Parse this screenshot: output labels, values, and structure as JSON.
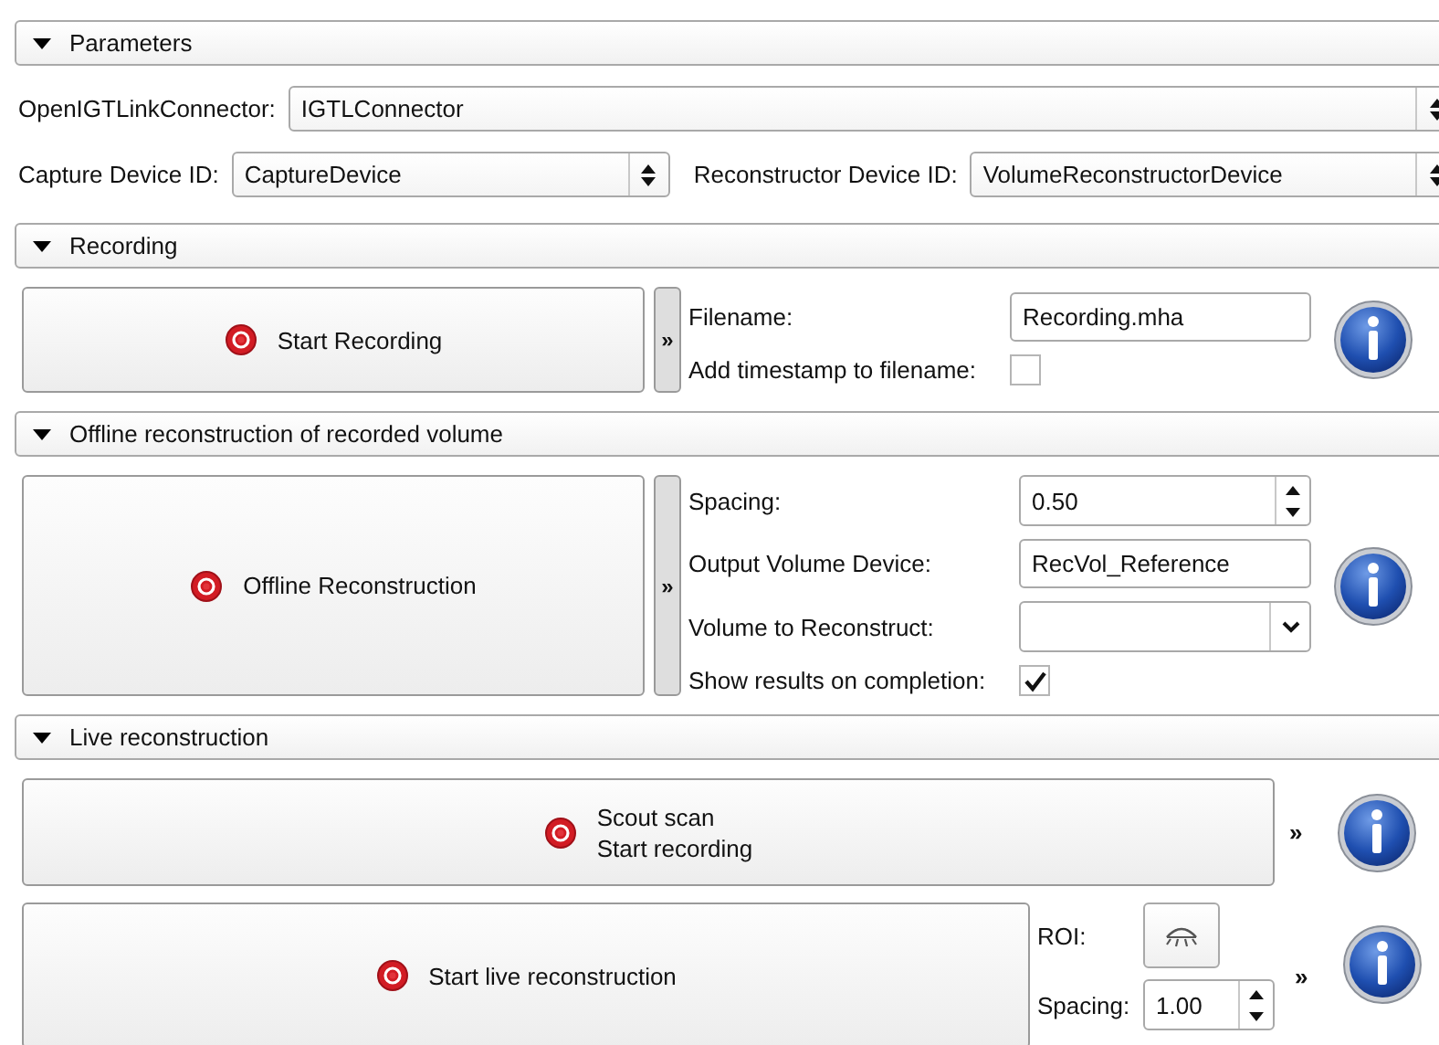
{
  "sections": [
    {
      "kind": "parameters",
      "title": "Parameters",
      "expanded": true,
      "rows": [
        [
          {
            "label": "OpenIGTLinkConnector:",
            "value": "IGTLConnector"
          }
        ],
        [
          {
            "label": "Capture Device ID:",
            "value": "CaptureDevice"
          },
          {
            "label": "Reconstructor Device ID:",
            "value": "VolumeReconstructorDevice"
          }
        ]
      ]
    },
    {
      "kind": "recording",
      "title": "Recording",
      "expanded": true,
      "button": "Start Recording",
      "expander": "»",
      "fields": [
        {
          "kind": "text",
          "label": "Filename:",
          "value": "Recording.mha"
        },
        {
          "kind": "checkbox",
          "label": "Add timestamp to filename:",
          "checked": false
        }
      ]
    },
    {
      "kind": "offline",
      "title": "Offline reconstruction of recorded volume",
      "expanded": true,
      "button": "Offline Reconstruction",
      "expander": "»",
      "fields": [
        {
          "kind": "spin",
          "label": "Spacing:",
          "value": "0.50"
        },
        {
          "kind": "text",
          "label": "Output Volume Device:",
          "value": "RecVol_Reference"
        },
        {
          "kind": "combo",
          "label": "Volume to Reconstruct:"
        },
        {
          "kind": "checkbox",
          "label": "Show results on completion:",
          "checked": true
        }
      ]
    },
    {
      "kind": "live",
      "title": "Live reconstruction",
      "expanded": true,
      "scout": {
        "lines": [
          "Scout scan",
          "Start recording"
        ],
        "expander": "»"
      },
      "live": {
        "button": "Start live reconstruction",
        "roi_label": "ROI:",
        "spacing_label": "Spacing:",
        "spacing": "1.00",
        "expander": "»"
      }
    }
  ]
}
